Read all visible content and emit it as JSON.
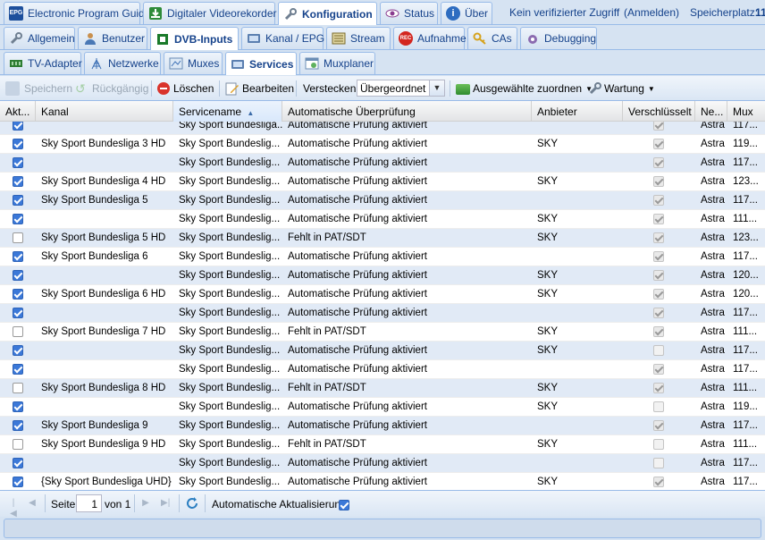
{
  "top_tabs": [
    {
      "label": "Electronic Program Guide",
      "icon": "epg-icon"
    },
    {
      "label": "Digitaler Videorekorder",
      "icon": "dvr-icon"
    },
    {
      "label": "Konfiguration",
      "icon": "wrench-icon",
      "active": true
    },
    {
      "label": "Status",
      "icon": "eye-icon"
    },
    {
      "label": "Über",
      "icon": "info-icon"
    }
  ],
  "status": {
    "access": "Kein verifizierter Zugriff",
    "login": "(Anmelden)",
    "storage": "Speicherplatz:",
    "storage_value": "11"
  },
  "config_tabs": [
    {
      "label": "Allgemein",
      "icon": "wrench-icon"
    },
    {
      "label": "Benutzer",
      "icon": "user-icon"
    },
    {
      "label": "DVB-Inputs",
      "icon": "dvb-icon",
      "active": true
    },
    {
      "label": "Kanal / EPG",
      "icon": "tv-icon"
    },
    {
      "label": "Stream",
      "icon": "stream-icon"
    },
    {
      "label": "Aufnahme",
      "icon": "rec-icon"
    },
    {
      "label": "CAs",
      "icon": "key-icon"
    },
    {
      "label": "Debugging",
      "icon": "debug-icon"
    }
  ],
  "dvb_tabs": [
    {
      "label": "TV-Adapter",
      "icon": "adapter-icon"
    },
    {
      "label": "Netzwerke",
      "icon": "network-icon"
    },
    {
      "label": "Muxes",
      "icon": "muxes-icon"
    },
    {
      "label": "Services",
      "icon": "services-icon",
      "active": true
    },
    {
      "label": "Muxplaner",
      "icon": "muxplaner-icon"
    }
  ],
  "toolbar": {
    "save": "Speichern",
    "undo": "Rückgängig",
    "delete": "Löschen",
    "edit": "Bearbeiten",
    "hide_label": "Verstecken:",
    "hide_value": "Übergeordnet d",
    "assign": "Ausgewählte zuordnen",
    "maintenance": "Wartung"
  },
  "columns": [
    "Akt...",
    "Kanal",
    "Servicename",
    "Automatische Überprüfung",
    "Anbieter",
    "Verschlüsselt",
    "Ne...",
    "Mux"
  ],
  "rows": [
    {
      "active": true,
      "kanal": "",
      "service": "Sky Sport Bundesliga...",
      "check": "Automatische Prüfung aktiviert",
      "provider": "",
      "enc": true,
      "net": "Astra",
      "mux": "117..."
    },
    {
      "active": true,
      "kanal": "Sky Sport Bundesliga 3 HD",
      "service": "Sky Sport Bundeslig...",
      "check": "Automatische Prüfung aktiviert",
      "provider": "SKY",
      "enc": true,
      "net": "Astra",
      "mux": "119..."
    },
    {
      "active": true,
      "kanal": "",
      "service": "Sky Sport Bundeslig...",
      "check": "Automatische Prüfung aktiviert",
      "provider": "",
      "enc": true,
      "net": "Astra",
      "mux": "117..."
    },
    {
      "active": true,
      "kanal": "Sky Sport Bundesliga 4 HD",
      "service": "Sky Sport Bundeslig...",
      "check": "Automatische Prüfung aktiviert",
      "provider": "SKY",
      "enc": true,
      "net": "Astra",
      "mux": "123..."
    },
    {
      "active": true,
      "kanal": "Sky Sport Bundesliga 5",
      "service": "Sky Sport Bundeslig...",
      "check": "Automatische Prüfung aktiviert",
      "provider": "",
      "enc": true,
      "net": "Astra",
      "mux": "117..."
    },
    {
      "active": true,
      "kanal": "",
      "service": "Sky Sport Bundeslig...",
      "check": "Automatische Prüfung aktiviert",
      "provider": "SKY",
      "enc": true,
      "net": "Astra",
      "mux": "111..."
    },
    {
      "active": false,
      "kanal": "Sky Sport Bundesliga 5 HD",
      "service": "Sky Sport Bundeslig...",
      "check": "Fehlt in PAT/SDT",
      "provider": "SKY",
      "enc": true,
      "net": "Astra",
      "mux": "123..."
    },
    {
      "active": true,
      "kanal": "Sky Sport Bundesliga 6",
      "service": "Sky Sport Bundeslig...",
      "check": "Automatische Prüfung aktiviert",
      "provider": "",
      "enc": true,
      "net": "Astra",
      "mux": "117..."
    },
    {
      "active": true,
      "kanal": "",
      "service": "Sky Sport Bundeslig...",
      "check": "Automatische Prüfung aktiviert",
      "provider": "SKY",
      "enc": true,
      "net": "Astra",
      "mux": "120..."
    },
    {
      "active": true,
      "kanal": "Sky Sport Bundesliga 6 HD",
      "service": "Sky Sport Bundeslig...",
      "check": "Automatische Prüfung aktiviert",
      "provider": "SKY",
      "enc": true,
      "net": "Astra",
      "mux": "120..."
    },
    {
      "active": true,
      "kanal": "",
      "service": "Sky Sport Bundeslig...",
      "check": "Automatische Prüfung aktiviert",
      "provider": "",
      "enc": true,
      "net": "Astra",
      "mux": "117..."
    },
    {
      "active": false,
      "kanal": "Sky Sport Bundesliga 7 HD",
      "service": "Sky Sport Bundeslig...",
      "check": "Fehlt in PAT/SDT",
      "provider": "SKY",
      "enc": true,
      "net": "Astra",
      "mux": "111..."
    },
    {
      "active": true,
      "kanal": "",
      "service": "Sky Sport Bundeslig...",
      "check": "Automatische Prüfung aktiviert",
      "provider": "SKY",
      "enc": false,
      "net": "Astra",
      "mux": "117..."
    },
    {
      "active": true,
      "kanal": "",
      "service": "Sky Sport Bundeslig...",
      "check": "Automatische Prüfung aktiviert",
      "provider": "",
      "enc": true,
      "net": "Astra",
      "mux": "117..."
    },
    {
      "active": false,
      "kanal": "Sky Sport Bundesliga 8 HD",
      "service": "Sky Sport Bundeslig...",
      "check": "Fehlt in PAT/SDT",
      "provider": "SKY",
      "enc": true,
      "net": "Astra",
      "mux": "111..."
    },
    {
      "active": true,
      "kanal": "",
      "service": "Sky Sport Bundeslig...",
      "check": "Automatische Prüfung aktiviert",
      "provider": "SKY",
      "enc": false,
      "net": "Astra",
      "mux": "119..."
    },
    {
      "active": true,
      "kanal": "Sky Sport Bundesliga 9",
      "service": "Sky Sport Bundeslig...",
      "check": "Automatische Prüfung aktiviert",
      "provider": "",
      "enc": true,
      "net": "Astra",
      "mux": "117..."
    },
    {
      "active": false,
      "kanal": "Sky Sport Bundesliga 9 HD",
      "service": "Sky Sport Bundeslig...",
      "check": "Fehlt in PAT/SDT",
      "provider": "SKY",
      "enc": false,
      "net": "Astra",
      "mux": "111..."
    },
    {
      "active": true,
      "kanal": "",
      "service": "Sky Sport Bundeslig...",
      "check": "Automatische Prüfung aktiviert",
      "provider": "",
      "enc": false,
      "net": "Astra",
      "mux": "117..."
    },
    {
      "active": true,
      "kanal": "{Sky Sport Bundesliga UHD}",
      "service": "Sky Sport Bundeslig...",
      "check": "Automatische Prüfung aktiviert",
      "provider": "SKY",
      "enc": true,
      "net": "Astra",
      "mux": "117..."
    }
  ],
  "pager": {
    "page_label": "Seite",
    "page_value": "1",
    "of_label": "von 1",
    "auto_refresh": "Automatische Aktualisierung"
  },
  "colors": {
    "accent": "#15428b",
    "border": "#99bbe8",
    "row_alt": "#e1eaf6"
  }
}
